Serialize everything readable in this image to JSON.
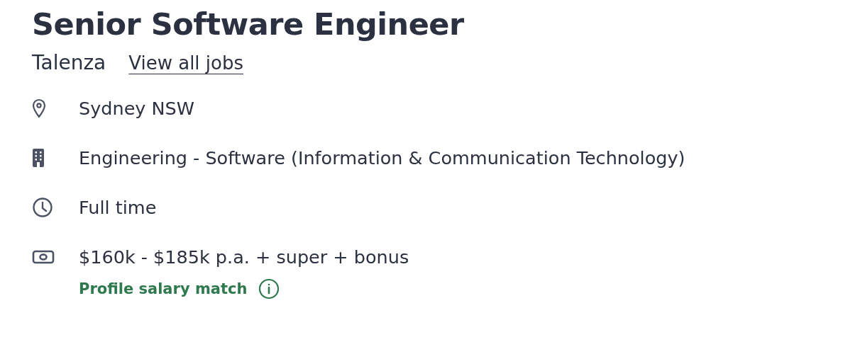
{
  "job": {
    "title": "Senior Software Engineer",
    "company": "Talenza",
    "view_all_link": "View all jobs"
  },
  "details": [
    {
      "kind": "location",
      "text": "Sydney NSW"
    },
    {
      "kind": "classification",
      "text": "Engineering - Software (Information & Communication Technology)"
    },
    {
      "kind": "work_type",
      "text": "Full time"
    },
    {
      "kind": "salary",
      "text": "$160k - $185k p.a. + super + bonus",
      "note": "Profile salary match"
    }
  ]
}
